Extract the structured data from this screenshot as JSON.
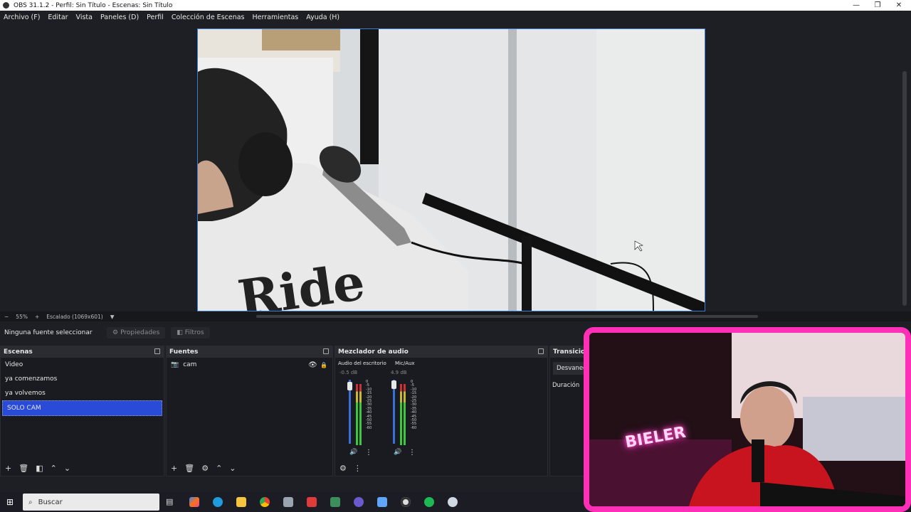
{
  "window": {
    "title": "OBS 31.1.2 - Perfil: Sin Título - Escenas: Sin Título",
    "minimize": "—",
    "maximize": "❐",
    "close": "✕"
  },
  "menu": [
    "Archivo (F)",
    "Editar",
    "Vista",
    "Paneles (D)",
    "Perfil",
    "Colección de Escenas",
    "Herramientas",
    "Ayuda (H)"
  ],
  "zoom": {
    "minus": "−",
    "value": "55%",
    "plus": "+",
    "mode": "Escalado (1069x601)",
    "arrow": "▼"
  },
  "properties_bar": {
    "no_source": "Ninguna fuente seleccionar",
    "properties": "Propiedades",
    "filters": "Filtros"
  },
  "scenes": {
    "title": "Escenas",
    "items": [
      "Video",
      "ya comenzamos",
      "ya volvemos",
      "SOLO CAM"
    ],
    "selected": "SOLO CAM"
  },
  "sources": {
    "title": "Fuentes",
    "items": [
      {
        "name": "cam",
        "icon": "camera-icon"
      }
    ]
  },
  "mixer": {
    "title": "Mezclador de audio",
    "channels": [
      {
        "name": "Audio del escritorio",
        "level": "-0.5 dB"
      },
      {
        "name": "Mic/Aux",
        "level": "4.9 dB"
      }
    ],
    "ticks": [
      "0",
      "-5",
      "-10",
      "-15",
      "-20",
      "-25",
      "-30",
      "-35",
      "-40",
      "-45",
      "-50",
      "-55",
      "-60"
    ]
  },
  "transitions": {
    "title": "Transicio",
    "type": "Desvanec",
    "duration_label": "Duración"
  },
  "taskbar": {
    "search_placeholder": "Buscar"
  },
  "overlay": {
    "neon_text": "BIELER"
  },
  "colors": {
    "accent": "#3a7bd5",
    "selection": "#2a4ad8",
    "overlay_frame": "#ff2fb8",
    "meter_green": "#3cc83c",
    "meter_yellow": "#c8b832",
    "meter_red": "#c83232"
  }
}
